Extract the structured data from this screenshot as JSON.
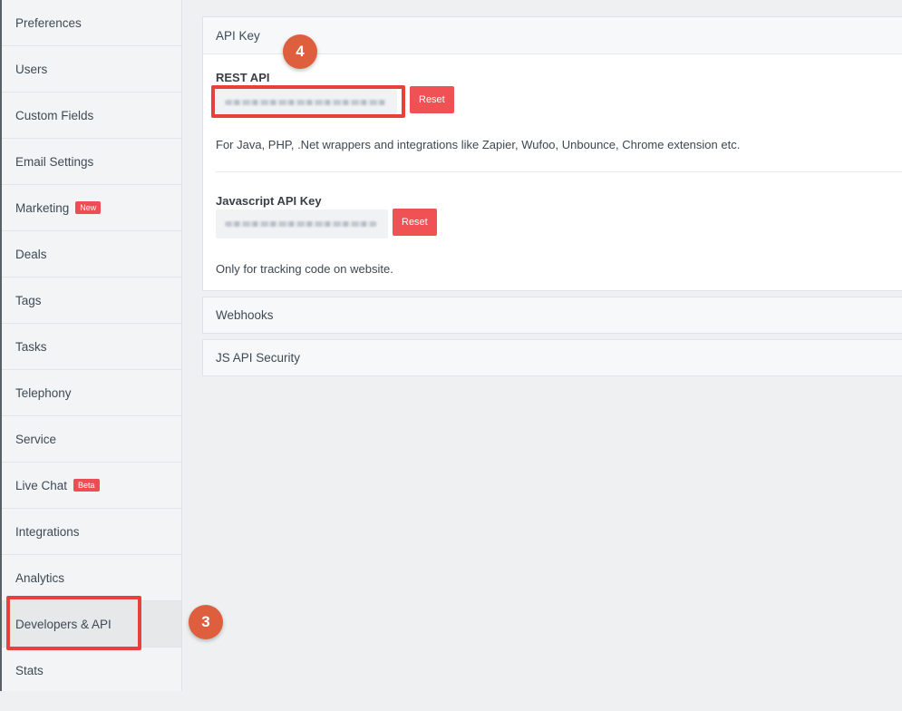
{
  "sidebar": {
    "items": [
      {
        "label": "Preferences"
      },
      {
        "label": "Users"
      },
      {
        "label": "Custom Fields"
      },
      {
        "label": "Email Settings"
      },
      {
        "label": "Marketing",
        "badge": "New"
      },
      {
        "label": "Deals"
      },
      {
        "label": "Tags"
      },
      {
        "label": "Tasks"
      },
      {
        "label": "Telephony"
      },
      {
        "label": "Service"
      },
      {
        "label": "Live Chat",
        "badge": "Beta"
      },
      {
        "label": "Integrations"
      },
      {
        "label": "Analytics"
      },
      {
        "label": "Developers & API"
      },
      {
        "label": "Stats"
      }
    ]
  },
  "api_key_panel": {
    "title": "API Key",
    "rest": {
      "label": "REST API",
      "reset_label": "Reset",
      "description": "For Java, PHP, .Net wrappers and integrations like Zapier, Wufoo, Unbounce, Chrome extension etc."
    },
    "js": {
      "label": "Javascript API Key",
      "reset_label": "Reset",
      "description": "Only for tracking code on website."
    }
  },
  "webhooks_panel": {
    "title": "Webhooks"
  },
  "js_security_panel": {
    "title": "JS API Security"
  },
  "annotations": {
    "step3": "3",
    "step4": "4"
  },
  "colors": {
    "accent": "#f05154",
    "highlight": "#e8413c",
    "step_circle": "#de5f3e"
  }
}
